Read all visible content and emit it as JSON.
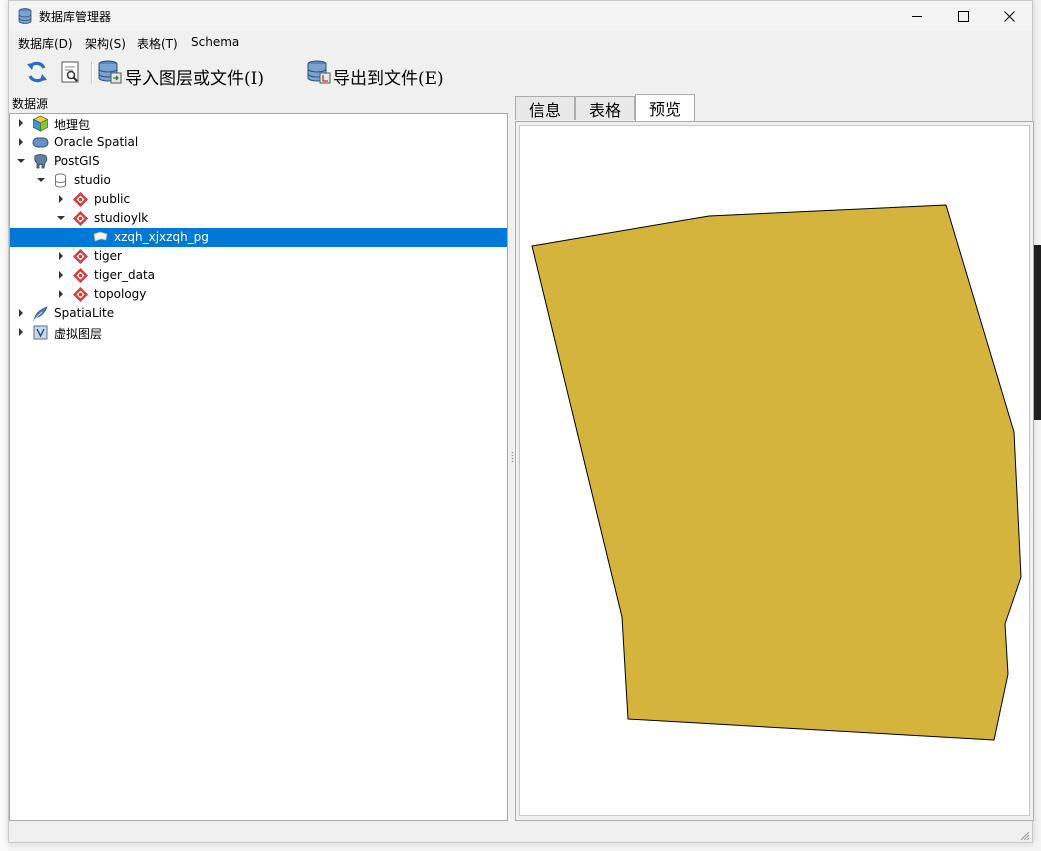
{
  "window": {
    "title": "数据库管理器"
  },
  "menu": {
    "items": [
      {
        "label": "数据库(D)"
      },
      {
        "label": "架构(S)"
      },
      {
        "label": "表格(T)"
      },
      {
        "label": "Schema"
      }
    ]
  },
  "toolbar": {
    "refresh_icon": "refresh-icon",
    "info_icon": "sql-window-icon",
    "import_label": "导入图层或文件(I)",
    "export_label": "导出到文件(E)"
  },
  "datasource": {
    "title": "数据源",
    "tree": [
      {
        "label": "地理包",
        "icon": "geopackage-icon"
      },
      {
        "label": "Oracle Spatial",
        "icon": "oracle-icon"
      },
      {
        "label": "PostGIS",
        "icon": "postgis-elephant-icon"
      },
      {
        "label": "studio",
        "icon": "database-icon"
      },
      {
        "label": "public",
        "icon": "schema-icon"
      },
      {
        "label": "studioylk",
        "icon": "schema-icon"
      },
      {
        "label": "xzqh_xjxzqh_pg",
        "icon": "polygon-layer-icon",
        "selected": true
      },
      {
        "label": "tiger",
        "icon": "schema-icon"
      },
      {
        "label": "tiger_data",
        "icon": "schema-icon"
      },
      {
        "label": "topology",
        "icon": "schema-icon"
      },
      {
        "label": "SpatiaLite",
        "icon": "spatialite-feather-icon"
      },
      {
        "label": "虚拟图层",
        "icon": "virtual-layer-icon"
      }
    ]
  },
  "tabs": [
    {
      "label": "信息"
    },
    {
      "label": "表格"
    },
    {
      "label": "预览",
      "active": true
    }
  ],
  "preview": {
    "fill_color": "#d4b43c",
    "stroke_color": "#000000"
  },
  "colors": {
    "selection": "#0078d7",
    "schema_icon": "#d63c3c"
  }
}
